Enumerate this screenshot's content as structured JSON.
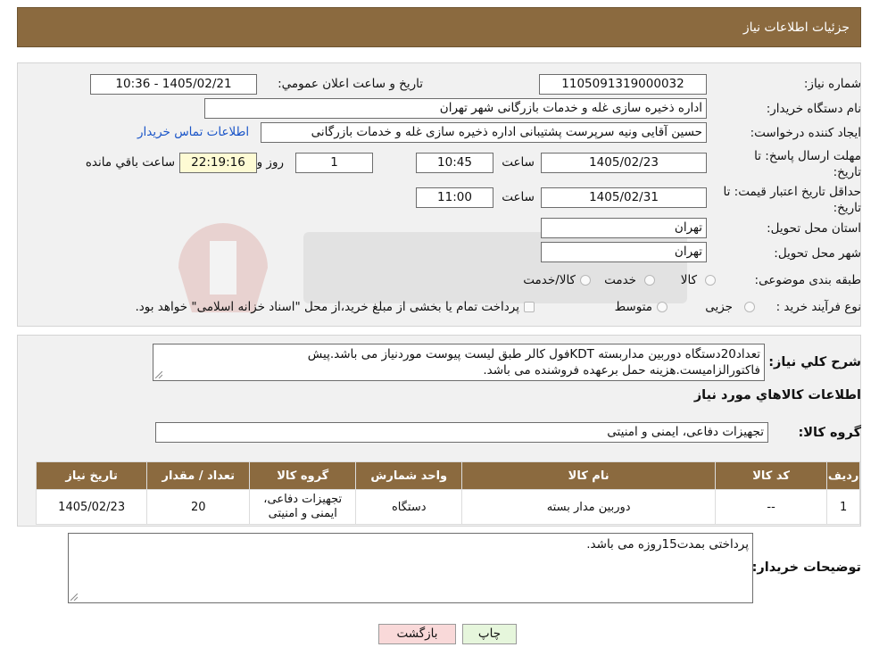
{
  "header": {
    "title": "جزئیات اطلاعات نیاز"
  },
  "form": {
    "need_number_label": "شماره نیاز:",
    "need_number": "1105091319000032",
    "announce_label": "تاریخ و ساعت اعلان عمومي:",
    "announce_value": "1405/02/21 - 10:36",
    "buyer_label": "نام دستگاه خریدار:",
    "buyer_value": "اداره ذخیره سازی غله و خدمات بازرگانی شهر تهران",
    "creator_label": "ایجاد کننده درخواست:",
    "creator_value": "حسین آقایی ونیه سرپرست پشتیبانی اداره ذخیره سازی غله و خدمات بازرگانی",
    "contact_link": "اطلاعات تماس خریدار",
    "deadline_label": "مهلت ارسال پاسخ: تا تاریخ:",
    "deadline_date": "1405/02/23",
    "time_label": "ساعت",
    "deadline_time": "10:45",
    "days_value": "1",
    "days_label": "روز و",
    "remaining_value": "22:19:16",
    "remaining_label": "ساعت باقي مانده",
    "validity_label": "حداقل تاریخ اعتبار قیمت: تا تاریخ:",
    "validity_date": "1405/02/31",
    "validity_time": "11:00",
    "province_label": "استان محل تحویل:",
    "province_value": "تهران",
    "city_label": "شهر محل تحویل:",
    "city_value": "تهران",
    "category_label": "طبقه بندی موضوعی:",
    "category_options": [
      "کالا",
      "خدمت",
      "کالا/خدمت"
    ],
    "process_label": "نوع فرآیند خرید :",
    "process_options": [
      "جزیی",
      "متوسط"
    ],
    "process_note": "پرداخت تمام یا بخشی از مبلغ خرید،از محل \"اسناد خزانه اسلامی\" خواهد بود."
  },
  "description": {
    "label": "شرح کلي نیاز:",
    "line1": "تعداد20دستگاه دوربین مداربسته KDTفول کالر طبق لیست پیوست موردنیاز می باشد.پیش",
    "line2": "فاکتورالزامیست.هزینه حمل برعهده فروشنده می باشد."
  },
  "goods": {
    "section_title": "اطلاعات کالاهاي مورد نیاز",
    "group_label": "گروه کالا:",
    "group_value": "تجهیزات دفاعی، ایمنی و امنیتی",
    "columns": [
      "ردیف",
      "کد کالا",
      "نام کالا",
      "واحد شمارش",
      "گروه کالا",
      "تعداد / مقدار",
      "تاریخ نیاز"
    ],
    "rows": [
      {
        "row": "1",
        "code": "--",
        "name": "دوربین مدار بسته",
        "unit": "دستگاه",
        "group": "تجهیزات دفاعی، ایمنی و امنیتی",
        "qty": "20",
        "date": "1405/02/23"
      }
    ]
  },
  "buyer_notes": {
    "label": "توضیحات خریدار:",
    "value": "پرداختی بمدت15روزه می باشد."
  },
  "buttons": {
    "print": "چاپ",
    "back": "بازگشت"
  },
  "colors": {
    "header": "#8b6a3f",
    "back_button": "#f9d9d9",
    "print_button": "#e6f6dc",
    "remaining_box": "#fefbd4",
    "link": "#1a55c8"
  }
}
